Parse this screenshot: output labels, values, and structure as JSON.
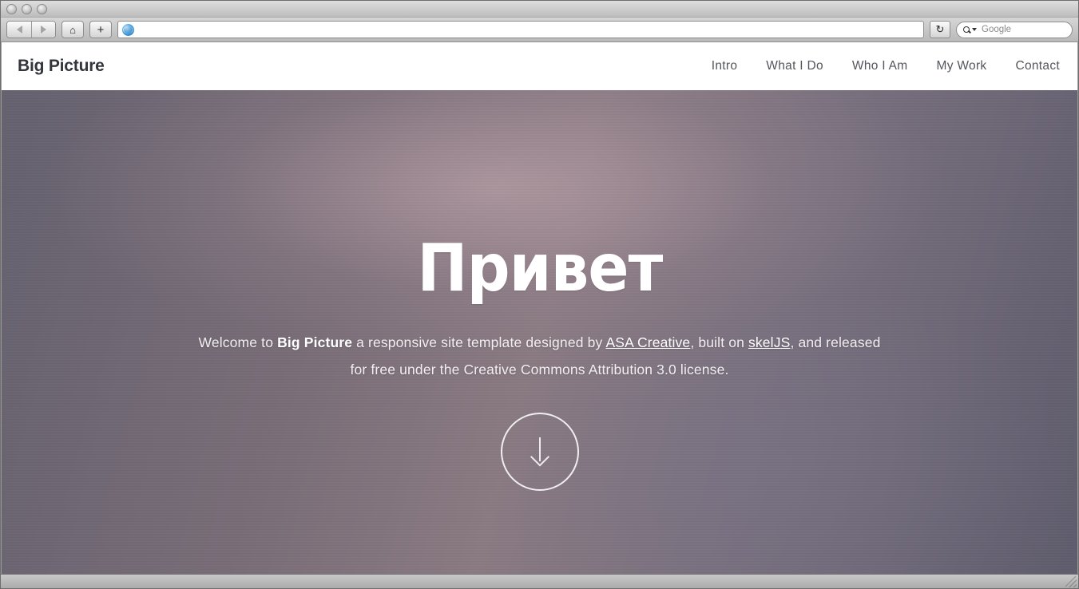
{
  "browser": {
    "back_label": "Back",
    "forward_label": "Forward",
    "home_label": "Home",
    "new_tab_label": "+",
    "url_value": "",
    "url_placeholder": "",
    "reload_glyph": "↻",
    "favicon_name": "globe-icon",
    "search_placeholder": "Google",
    "search_value": "Google"
  },
  "site": {
    "logo": "Big Picture",
    "nav": [
      {
        "label": "Intro"
      },
      {
        "label": "What I Do"
      },
      {
        "label": "Who I Am"
      },
      {
        "label": "My Work"
      },
      {
        "label": "Contact"
      }
    ]
  },
  "hero": {
    "title": "Привет",
    "line1_a": "Welcome to ",
    "line1_strong": "Big Picture",
    "line1_b": " a responsive site template designed by ",
    "link1": "ASA Creative",
    "line1_c": ", built on ",
    "link2": "skelJS",
    "line1_d": ", and",
    "line2": "released for free under the Creative Commons Attribution 3.0 license.",
    "scroll_label": "Scroll down"
  },
  "colors": {
    "logo": "#32363c",
    "nav_link": "#53565c",
    "hero_bg_left": "#65616f",
    "hero_bg_center": "#8a7a82",
    "hero_bg_right": "#5f5c6d",
    "hero_text": "#f2eff1",
    "header_bg": "#ffffff"
  }
}
